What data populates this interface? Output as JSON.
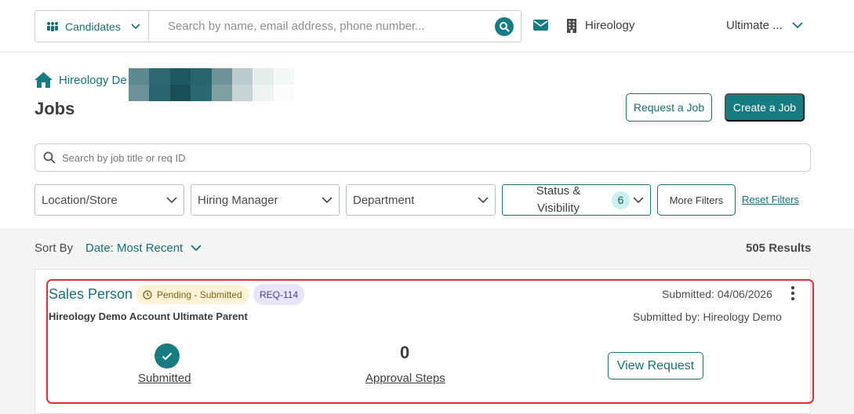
{
  "topbar": {
    "candidates_label": "Candidates",
    "search_placeholder": "Search by name, email address, phone number...",
    "org_name": "Hireology",
    "user_name": "Ultimate ..."
  },
  "header": {
    "breadcrumb": "Hireology De",
    "title": "Jobs",
    "request_job_label": "Request a Job",
    "create_job_label": "Create a Job"
  },
  "filters": {
    "job_search_placeholder": "Search by job title or req ID",
    "location": "Location/Store",
    "hiring_manager": "Hiring Manager",
    "department": "Department",
    "status_visibility": "Status & Visibility",
    "status_count": "6",
    "more_filters": "More Filters",
    "reset_filters": "Reset Filters"
  },
  "results": {
    "sort_by_label": "Sort By",
    "sort_value": "Date: Most Recent",
    "count": "505 Results"
  },
  "job_card": {
    "title": "Sales Person",
    "status_badge": "Pending - Submitted",
    "req_id": "REQ-114",
    "account": "Hireology Demo Account Ultimate Parent",
    "submitted_date": "Submitted: 04/06/2026",
    "submitted_by": "Submitted by: Hireology Demo",
    "step_submitted": "Submitted",
    "approval_steps_count": "0",
    "approval_steps_label": "Approval Steps",
    "view_request_label": "View Request"
  },
  "icons": [
    "people-icon",
    "chevron-down-icon",
    "search-icon",
    "mail-icon",
    "building-icon",
    "home-icon",
    "clock-icon",
    "kebab-icon",
    "check-icon"
  ],
  "colors": {
    "accent": "#177b82",
    "highlight": "#d3333b",
    "pending_bg": "#fdf2d5",
    "req_bg": "#e8e4fb",
    "count_badge_bg": "#c9f2ee"
  }
}
